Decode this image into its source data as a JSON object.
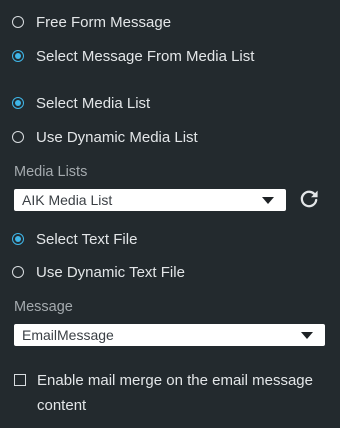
{
  "message_source": {
    "free_form": "Free Form Message",
    "from_media_list": "Select Message From Media List",
    "selected": "from_media_list"
  },
  "media_list_mode": {
    "select": "Select Media List",
    "dynamic": "Use Dynamic Media List",
    "selected": "select"
  },
  "media_lists": {
    "label": "Media Lists",
    "value": "AIK Media List"
  },
  "text_file_mode": {
    "select": "Select Text File",
    "dynamic": "Use Dynamic Text File",
    "selected": "select"
  },
  "message": {
    "label": "Message",
    "value": "EmailMessage"
  },
  "mail_merge": {
    "label": "Enable mail merge on the email message content",
    "checked": false
  },
  "icons": {
    "refresh": "refresh-icon",
    "dropdown": "chevron-down-icon"
  },
  "colors": {
    "background": "#232a2e",
    "accent": "#3fb6e8",
    "text": "#e3e6e8",
    "muted_label": "#a4aaae"
  }
}
